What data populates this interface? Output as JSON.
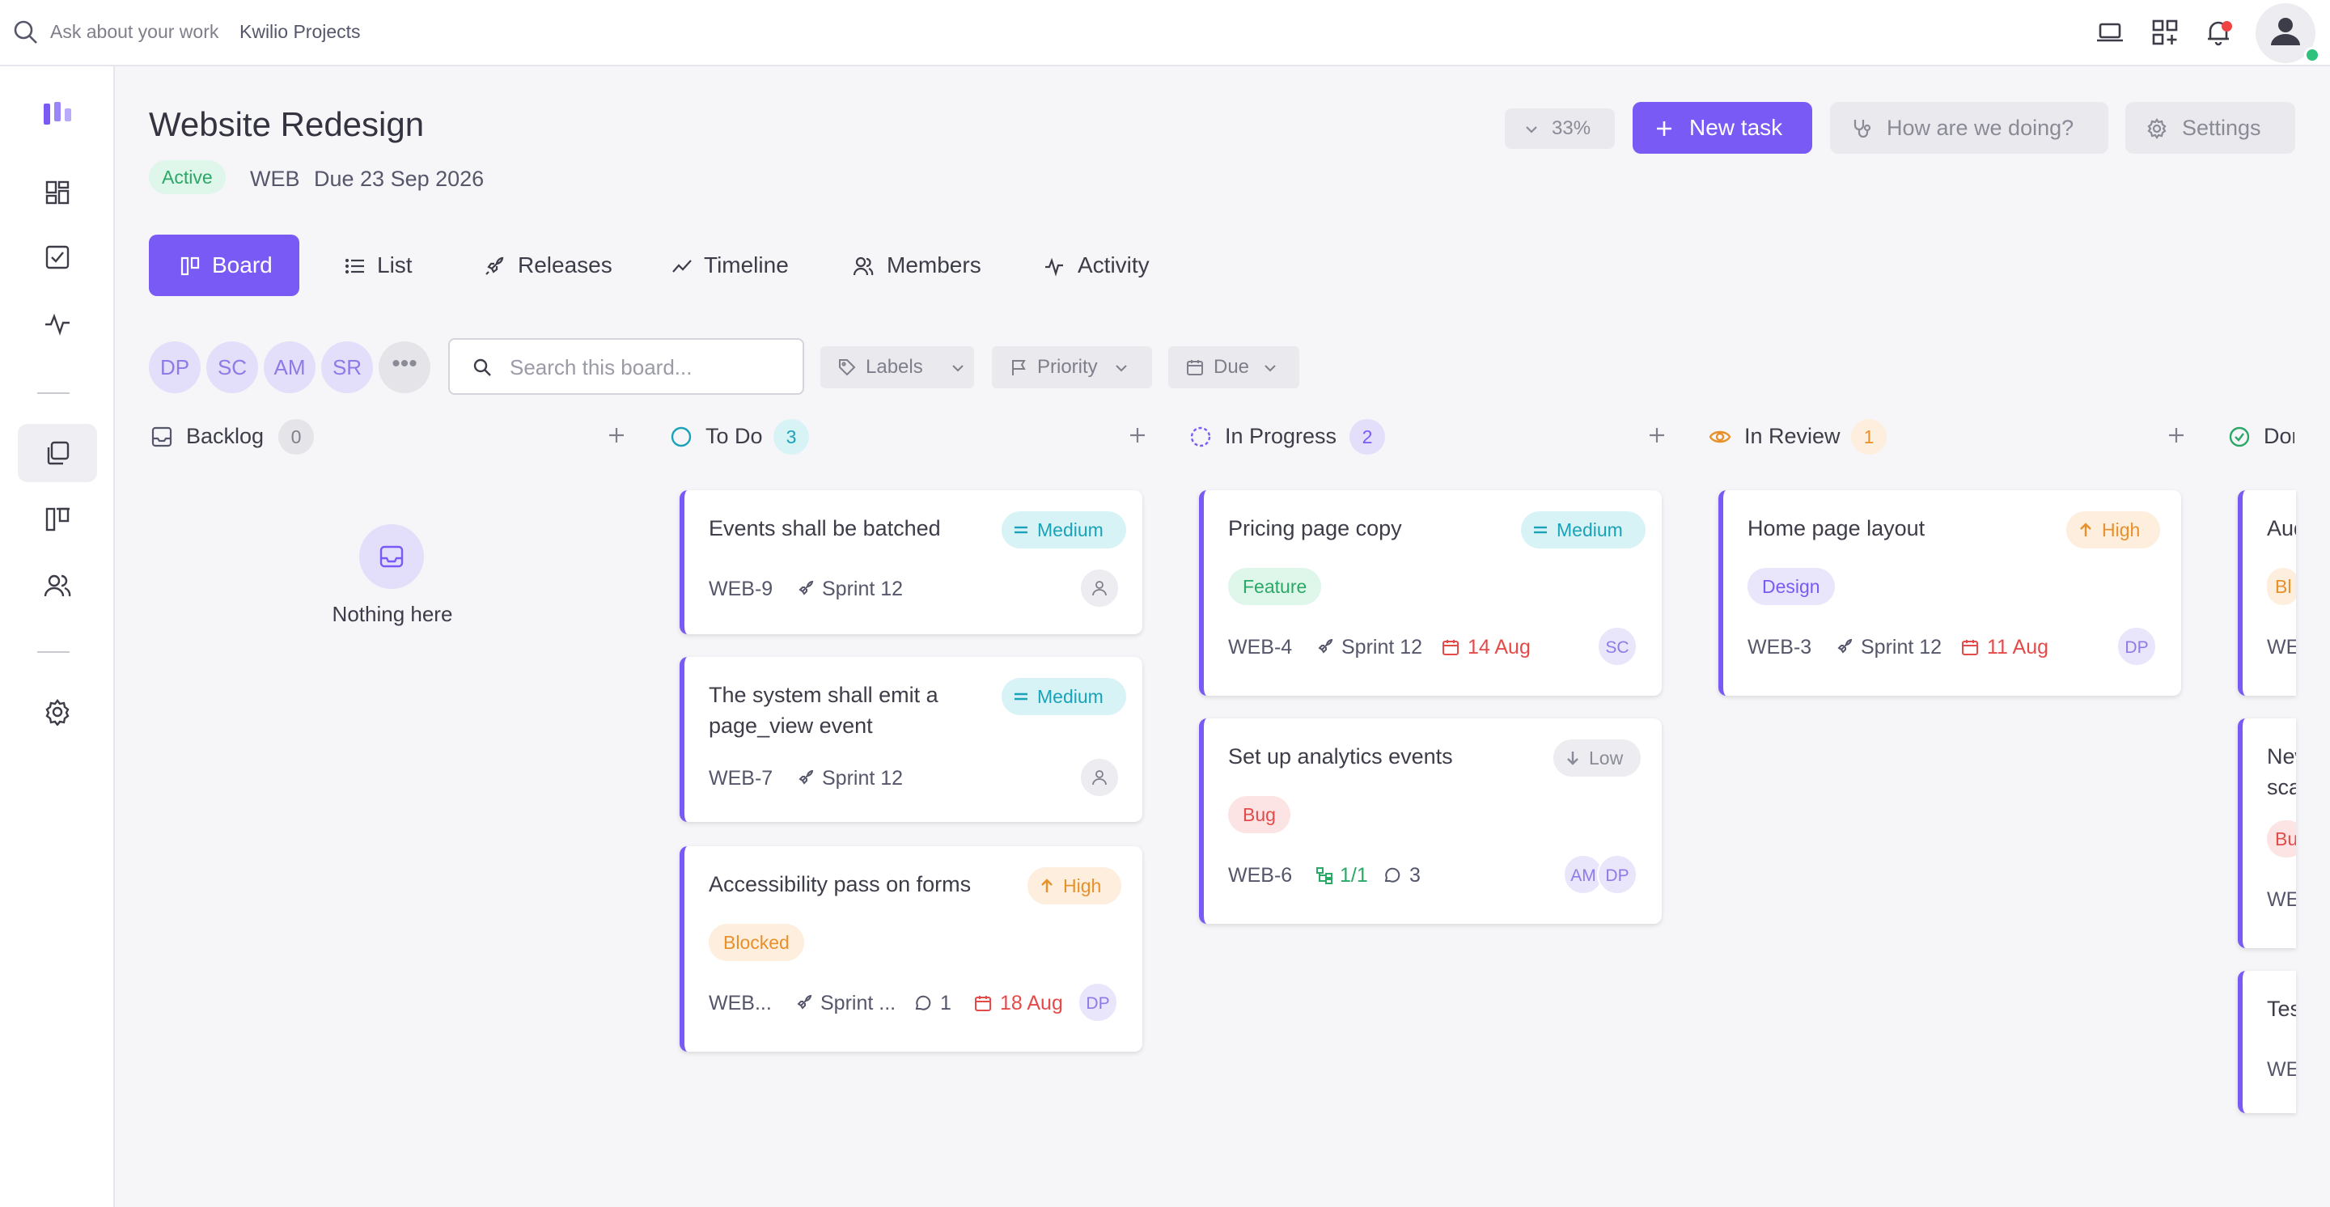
{
  "topbar": {
    "search_placeholder": "Ask about your work",
    "project_name": "Kwilio Projects"
  },
  "header": {
    "title": "Website Redesign",
    "status": "Active",
    "key": "WEB",
    "due": "Due 23 Sep 2026",
    "zoom": "33%",
    "new_task": "New task",
    "feedback": "How are we doing?",
    "settings": "Settings"
  },
  "tabs": [
    {
      "label": "Board",
      "active": true
    },
    {
      "label": "List"
    },
    {
      "label": "Releases"
    },
    {
      "label": "Timeline"
    },
    {
      "label": "Members"
    },
    {
      "label": "Activity"
    }
  ],
  "filters": {
    "avatars": [
      "DP",
      "SC",
      "AM",
      "SR"
    ],
    "more": "•••",
    "search_placeholder": "Search this board...",
    "labels": "Labels",
    "priority": "Priority",
    "due": "Due"
  },
  "columns": {
    "backlog": {
      "name": "Backlog",
      "count": "0",
      "empty": "Nothing here"
    },
    "todo": {
      "name": "To Do",
      "count": "3"
    },
    "inprogress": {
      "name": "In Progress",
      "count": "2"
    },
    "inreview": {
      "name": "In Review",
      "count": "1"
    },
    "done": {
      "name": "Done"
    }
  },
  "cards": {
    "c1": {
      "title": "Events shall be batched",
      "priority": "Medium",
      "id": "WEB-9",
      "sprint": "Sprint 12"
    },
    "c2": {
      "title": "The system shall emit a page_view event",
      "priority": "Medium",
      "id": "WEB-7",
      "sprint": "Sprint 12"
    },
    "c3": {
      "title": "Accessibility pass on forms",
      "priority": "High",
      "label": "Blocked",
      "id": "WEB...",
      "sprint": "Sprint ...",
      "comments": "1",
      "due": "18 Aug",
      "assignee": "DP"
    },
    "c4": {
      "title": "Pricing page copy",
      "priority": "Medium",
      "label": "Feature",
      "id": "WEB-4",
      "sprint": "Sprint 12",
      "due": "14 Aug",
      "assignee": "SC"
    },
    "c5": {
      "title": "Set up analytics events",
      "priority": "Low",
      "label": "Bug",
      "id": "WEB-6",
      "subtasks": "1/1",
      "comments": "3",
      "assignees": [
        "AM",
        "DP"
      ]
    },
    "c6": {
      "title": "Home page layout",
      "priority": "High",
      "label": "Design",
      "id": "WEB-3",
      "sprint": "Sprint 12",
      "due": "11 Aug",
      "assignee": "DP"
    },
    "d1": {
      "title": "Aud",
      "label": "Bl",
      "id": "WEB"
    },
    "d2": {
      "title": "New sca",
      "label": "Bu",
      "id": "WEB"
    },
    "d3": {
      "title": "Tes",
      "id": "WEB"
    }
  },
  "colors": {
    "accent": "#7a5af5",
    "active": "#2aa866",
    "danger": "#e34b4b",
    "warning": "#e8902a",
    "info": "#1aa3b8"
  }
}
